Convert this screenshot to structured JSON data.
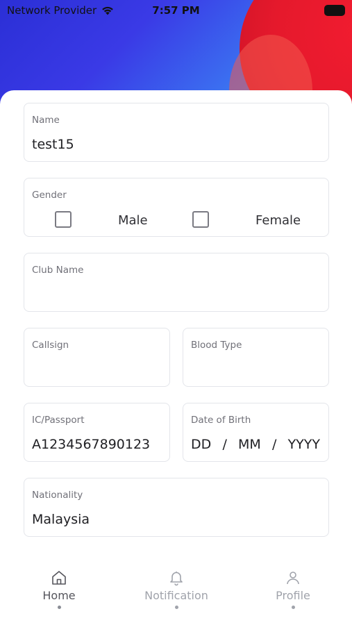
{
  "status_bar": {
    "carrier": "Network Provider",
    "time": "7:57 PM"
  },
  "form": {
    "name": {
      "label": "Name",
      "value": "test15"
    },
    "gender": {
      "label": "Gender",
      "option_male": "Male",
      "option_female": "Female",
      "male_checked": false,
      "female_checked": false
    },
    "club_name": {
      "label": "Club Name",
      "value": ""
    },
    "callsign": {
      "label": "Callsign",
      "value": ""
    },
    "blood_type": {
      "label": "Blood Type",
      "value": ""
    },
    "ic_passport": {
      "label": "IC/Passport",
      "value": "A1234567890123"
    },
    "date_of_birth": {
      "label": "Date of Birth",
      "day": "DD",
      "sep1": "/",
      "month": "MM",
      "sep2": "/",
      "year": "YYYY"
    },
    "nationality": {
      "label": "Nationality",
      "value": "Malaysia"
    }
  },
  "tabbar": {
    "tabs": [
      {
        "label": "Home",
        "icon": "home-icon",
        "active": true
      },
      {
        "label": "Notification",
        "icon": "bell-icon",
        "active": false
      },
      {
        "label": "Profile",
        "icon": "profile-icon",
        "active": false
      }
    ]
  },
  "colors": {
    "active_tab": "#55555c",
    "inactive_tab": "#a0a3ab",
    "field_border": "#e3e5ea"
  }
}
